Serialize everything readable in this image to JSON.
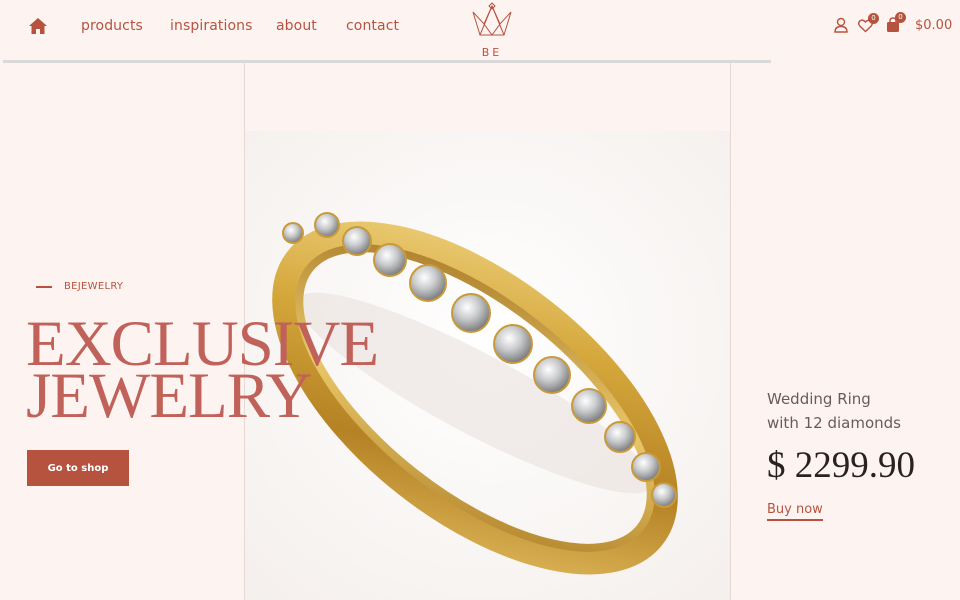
{
  "header": {
    "nav": [
      "products",
      "inspirations",
      "about",
      "contact"
    ],
    "logo_text": "BE",
    "wishlist_count": "0",
    "cart_count": "0",
    "cart_total": "$0.00"
  },
  "hero": {
    "eyebrow": "BEJEWELRY",
    "title_line1": "EXCLUSIVE",
    "title_line2": "JEWELRY",
    "cta_label": "Go to shop"
  },
  "product": {
    "name_line1": "Wedding Ring",
    "name_line2": "with 12 diamonds",
    "price": "$ 2299.90",
    "buy_label": "Buy now"
  },
  "colors": {
    "accent": "#b5533e",
    "title": "#c0625a",
    "background": "#fdf4f2",
    "gold": "#d4a63a"
  },
  "icons": [
    "home-icon",
    "user-icon",
    "heart-icon",
    "shopping-bag-icon",
    "crown-logo-icon"
  ]
}
